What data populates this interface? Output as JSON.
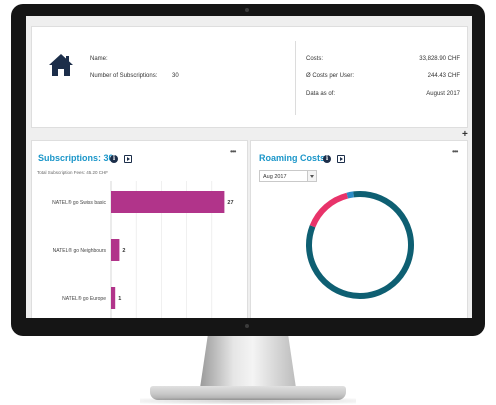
{
  "summary": {
    "name_label": "Name:",
    "name_value": "",
    "subscriptions_label": "Number of Subscriptions:",
    "subscriptions_value": "30",
    "costs_label": "Costs:",
    "costs_value": "33,828.90 CHF",
    "avg_costs_label": "Ø Costs per User:",
    "avg_costs_value": "244.43 CHF",
    "data_as_of_label": "Data as of:",
    "data_as_of_value": "August 2017"
  },
  "add_label": "+",
  "subscriptions_panel": {
    "title": "Subscriptions: 30",
    "info_glyph": "i",
    "menu_glyph": "•••",
    "caption": "Total Subscription Fees: 45.20 CHF",
    "chart_data": {
      "type": "bar",
      "orientation": "horizontal",
      "categories": [
        "NATEL® go Swiss basic",
        "NATEL® go Neighbours",
        "NATEL® go Europe"
      ],
      "values": [
        27,
        2,
        1
      ],
      "xlim": [
        0,
        30
      ],
      "grid": true,
      "color": "#b1348a"
    }
  },
  "roaming_panel": {
    "title": "Roaming Costs",
    "info_glyph": "i",
    "menu_glyph": "•••",
    "month_selected": "Aug 2017",
    "chart_data": {
      "type": "pie",
      "donut": true,
      "slices": [
        {
          "value": 81,
          "color": "#0e5f72"
        },
        {
          "value": 15,
          "color": "#e8336a"
        },
        {
          "value": 2,
          "color": "#2a8ac4"
        },
        {
          "value": 2,
          "color": "#0e5f72"
        }
      ]
    }
  },
  "colors": {
    "accent_blue": "#1b96c9",
    "bar_magenta": "#b1348a",
    "donut_teal": "#0e5f72",
    "donut_pink": "#e8336a",
    "navy_icon": "#1c2e4a"
  },
  "icons": {
    "home": "home-icon",
    "info": "info-icon",
    "export": "export-icon",
    "menu": "more-icon",
    "add": "plus-icon",
    "dropdown": "chevron-down-icon"
  }
}
